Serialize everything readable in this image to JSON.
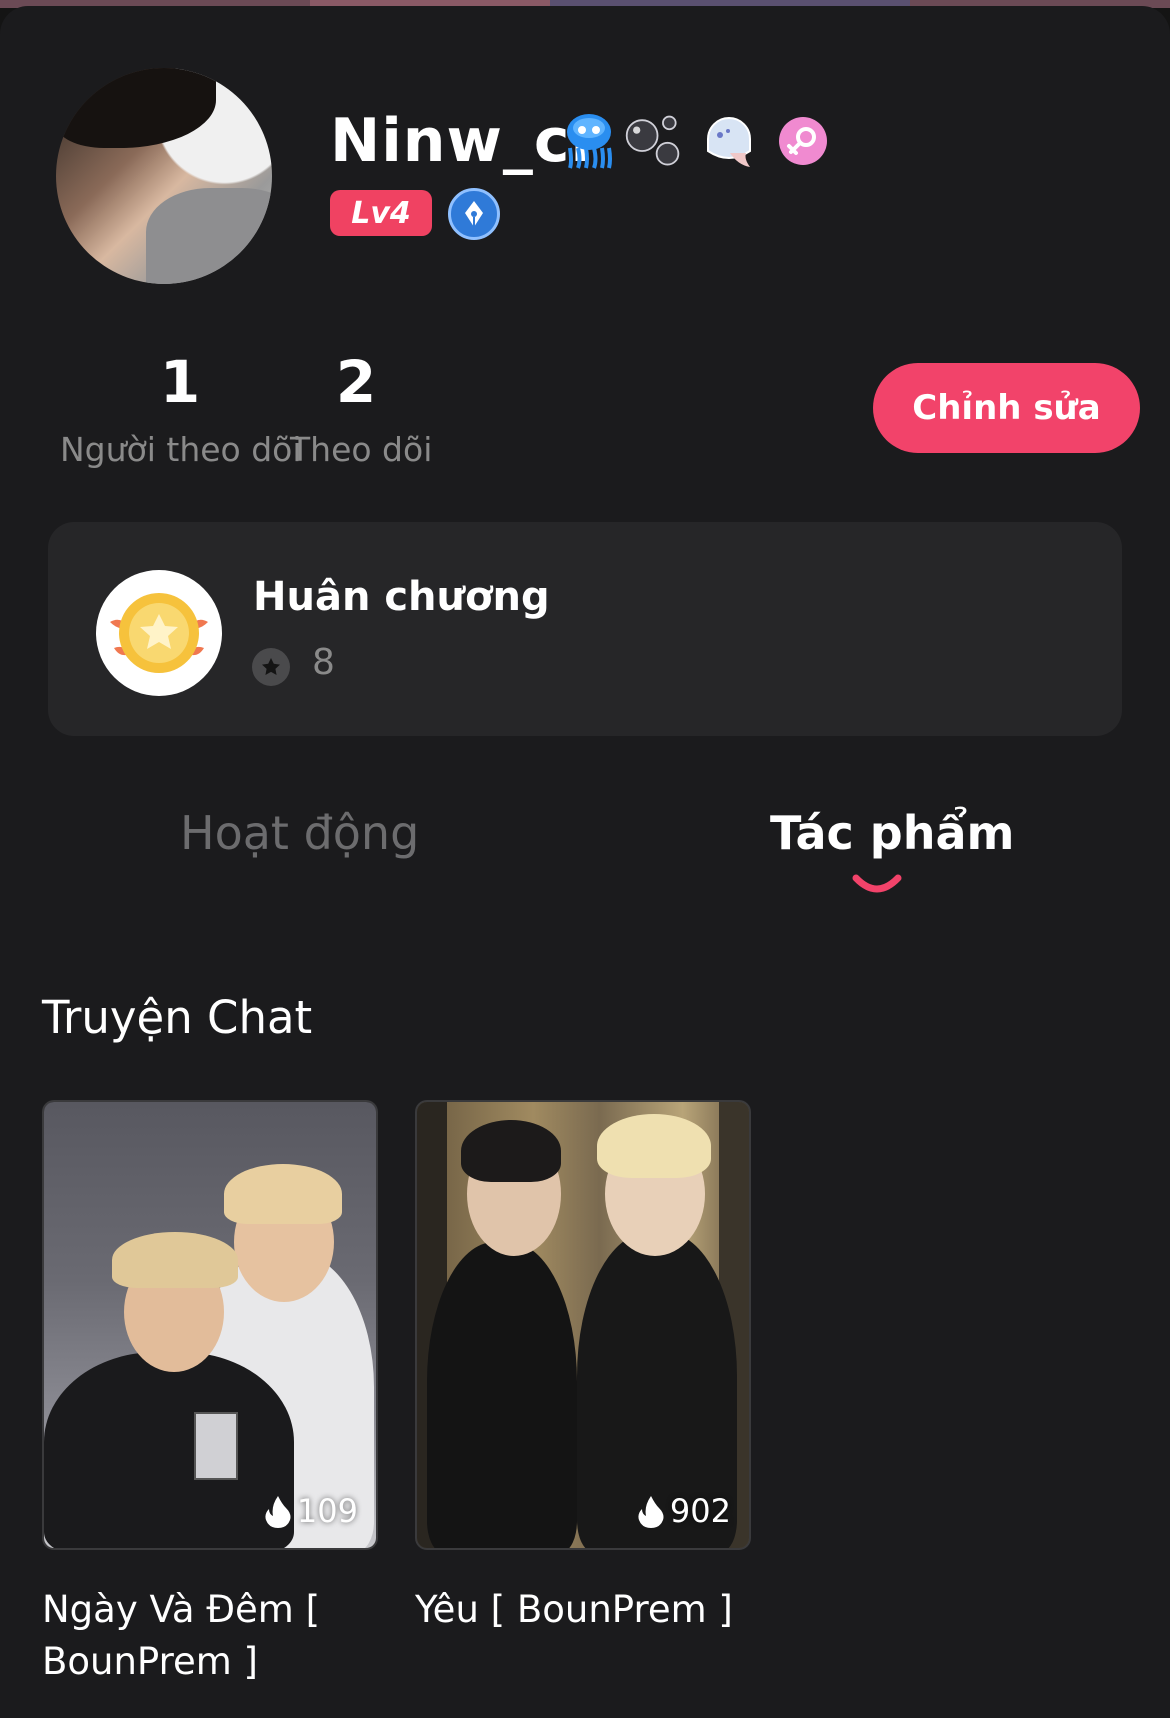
{
  "profile": {
    "username": "Ninw_cr",
    "level": "Lv4",
    "badges": [
      "jellyfish-icon",
      "bubbles-icon",
      "ghost-icon",
      "female-icon"
    ],
    "verified_icon": "fountain-pen-icon"
  },
  "stats": {
    "followers_count": "1",
    "followers_label": "Người theo dõi",
    "following_count": "2",
    "following_label": "Theo dõi"
  },
  "edit_button": "Chỉnh sửa",
  "medals": {
    "title": "Huân chương",
    "count": "8"
  },
  "tabs": [
    {
      "label": "Hoạt động",
      "active": false
    },
    {
      "label": "Tác phẩm",
      "active": true
    }
  ],
  "section_title": "Truyện Chat",
  "stories": [
    {
      "title": "Ngày Và Đêm [ BounPrem ]",
      "views": "109"
    },
    {
      "title": "Yêu [ BounPrem ]",
      "views": "902"
    }
  ],
  "colors": {
    "accent": "#f2436a",
    "background": "#1b1b1d",
    "card": "#262628",
    "muted": "#8a8a8a"
  }
}
